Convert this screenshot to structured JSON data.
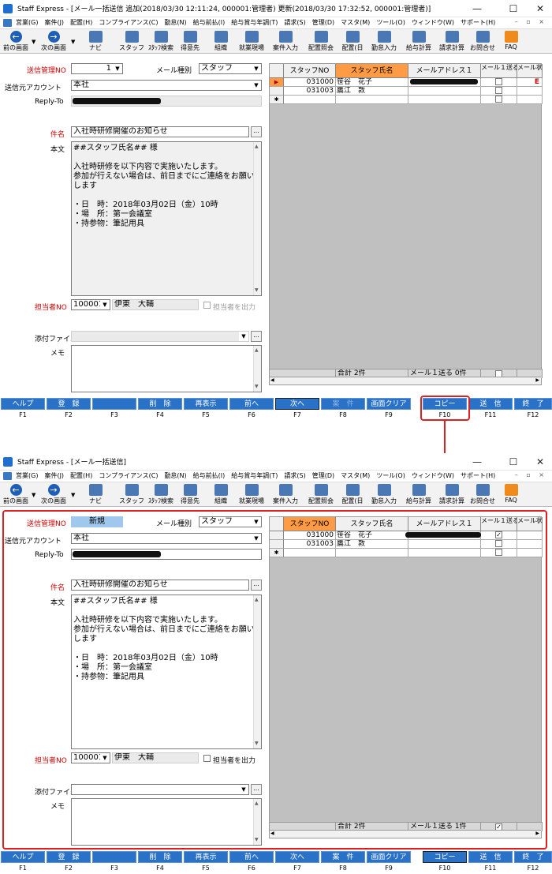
{
  "title_before": "Staff Express - [メール一括送信  追加(2018/03/30 12:11:24, 000001:管理者) 更新(2018/03/30 17:32:52, 000001:管理者)]",
  "title_after": "Staff Express - [メール一括送信]",
  "window_buttons": [
    "—",
    "☐",
    "✕"
  ],
  "menus": [
    "営業(G)",
    "案件(J)",
    "配置(H)",
    "コンプライアンス(C)",
    "勤怠(N)",
    "給与前払(I)",
    "給与賞与年調(T)",
    "請求(S)",
    "管理(D)",
    "マスタ(M)",
    "ツール(O)",
    "ウィンドウ(W)",
    "サポート(H)"
  ],
  "toolbar": {
    "prev": "前の画面",
    "next": "次の画面",
    "nav": "ナビ",
    "staff": "スタッフ",
    "staff_search": "ｽﾀｯﾌ検索",
    "client": "得意先",
    "org": "組織",
    "site": "就業現場",
    "job_input": "案件入力",
    "assign_inquiry": "配置照会",
    "assign_day": "配置(日",
    "attendance_input": "勤怠入力",
    "salary_calc": "給与計算",
    "billing_calc": "請求計算",
    "contact": "お問合せ",
    "faq": "FAQ"
  },
  "form": {
    "send_no_label": "送信管理NO",
    "send_no_value": "1",
    "send_no_new": "新規",
    "mail_type_label": "メール種別",
    "mail_type_value": "スタッフ",
    "account_label": "送信元アカウント",
    "account_value": "本社",
    "replyto_label": "Reply-To",
    "subject_label": "件名",
    "subject_value": "入社時研修開催のお知らせ",
    "body_label": "本文",
    "body_value": "##スタッフ氏名## 様\n\n入社時研修を以下内容で実施いたします。\n参加が行えない場合は、前日までにご連絡をお願いします\n\n・日　時：2018年03月02日（金）10時\n・場　所：第一会議室\n・持参物：筆記用具",
    "person_label": "担当者NO",
    "person_code": "100001",
    "person_name": "伊東　大輔",
    "person_output_label": "担当者を出力",
    "attach_label": "添付ファイル",
    "memo_label": "メモ",
    "dots": "..."
  },
  "grid": {
    "headers": [
      "スタッフNO",
      "スタッフ氏名",
      "メールアドレス１",
      "メール１送る",
      "メール状態"
    ],
    "rows": [
      {
        "no": "031000",
        "name": "笹谷　花子"
      },
      {
        "no": "031003",
        "name": "鷹江　敦"
      }
    ],
    "new_row_marker": "✱",
    "cur_row_marker": "▶",
    "status_mark": "E",
    "check_mark": "✓",
    "total": "合計 2件",
    "mail_send_before": "メール１送る  0件",
    "mail_send_after": "メール１送る  1件"
  },
  "fkeys": [
    {
      "label": "ヘルプ",
      "key": "F1"
    },
    {
      "label": "登　録",
      "key": "F2"
    },
    {
      "label": "",
      "key": "F3"
    },
    {
      "label": "削　除",
      "key": "F4"
    },
    {
      "label": "再表示",
      "key": "F5"
    },
    {
      "label": "前へ",
      "key": "F6"
    },
    {
      "label": "次へ",
      "key": "F7"
    },
    {
      "label": "案　件",
      "key": "F8"
    },
    {
      "label": "画面クリア",
      "key": "F9"
    },
    {
      "label": "コピー",
      "key": "F10"
    },
    {
      "label": "送　信",
      "key": "F11"
    },
    {
      "label": "終　了",
      "key": "F12"
    }
  ],
  "colors": {
    "accent": "#2a72c8",
    "highlight": "#e02020",
    "header_orange": "#ff9b45",
    "new_badge": "#9fc8ec"
  }
}
